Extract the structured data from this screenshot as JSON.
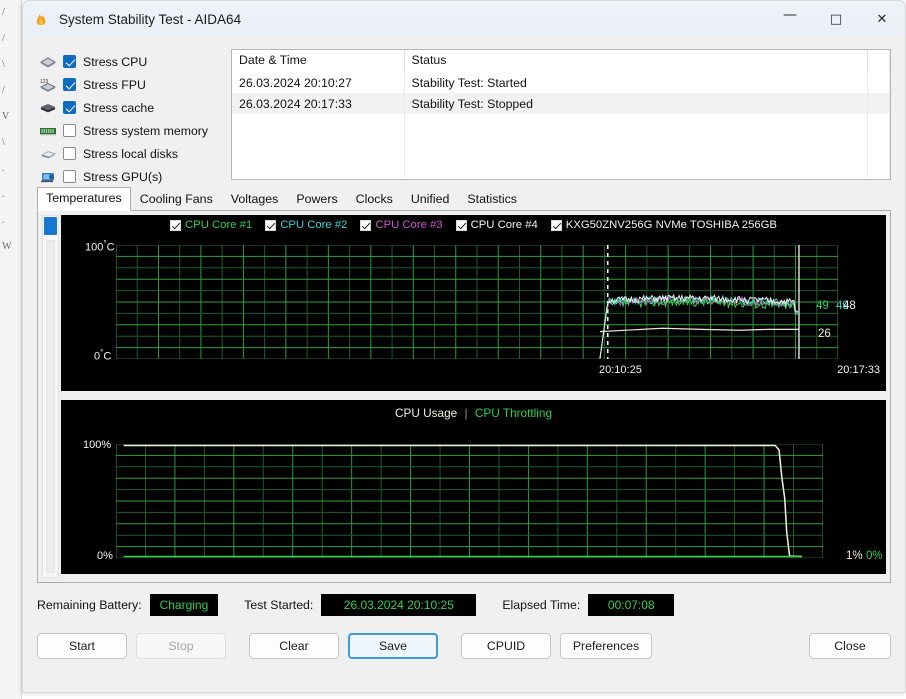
{
  "window": {
    "title": "System Stability Test - AIDA64",
    "app_icon": "aida64-flame-icon",
    "controls": {
      "minimize": "—",
      "maximize": "□",
      "close": "✕"
    }
  },
  "options": {
    "items": [
      {
        "label": "Stress CPU",
        "checked": true,
        "icon": "cpu-chip-icon"
      },
      {
        "label": "Stress FPU",
        "checked": true,
        "icon": "fpu-chip-icon"
      },
      {
        "label": "Stress cache",
        "checked": true,
        "icon": "cache-chip-icon"
      },
      {
        "label": "Stress system memory",
        "checked": false,
        "icon": "memory-module-icon"
      },
      {
        "label": "Stress local disks",
        "checked": false,
        "icon": "hard-disk-icon"
      },
      {
        "label": "Stress GPU(s)",
        "checked": false,
        "icon": "gpu-card-icon"
      }
    ]
  },
  "log": {
    "columns": [
      "Date & Time",
      "Status"
    ],
    "rows": [
      {
        "datetime": "26.03.2024 20:10:27",
        "status": "Stability Test: Started"
      },
      {
        "datetime": "26.03.2024 20:17:33",
        "status": "Stability Test: Stopped"
      }
    ]
  },
  "tabs": {
    "items": [
      "Temperatures",
      "Cooling Fans",
      "Voltages",
      "Powers",
      "Clocks",
      "Unified",
      "Statistics"
    ],
    "active": "Temperatures"
  },
  "temperature_graph": {
    "legend": [
      {
        "label": "CPU Core #1",
        "checked": true,
        "color": "#2fd14f"
      },
      {
        "label": "CPU Core #2",
        "checked": true,
        "color": "#36d6d6"
      },
      {
        "label": "CPU Core #3",
        "checked": true,
        "color": "#d152d1"
      },
      {
        "label": "CPU Core #4",
        "checked": true,
        "color": "#f2f2f2"
      },
      {
        "label": "KXG50ZNV256G NVMe TOSHIBA 256GB",
        "checked": true,
        "color": "#f2f2f2"
      }
    ],
    "y_top": "100",
    "y_bottom": "0",
    "y_unit": "C",
    "y_degree": "°",
    "x_start": "20:10:25",
    "x_end": "20:17:33",
    "readouts": [
      {
        "value": "49",
        "color": "#2fd14f"
      },
      {
        "value": "49",
        "color": "#36d6d6"
      },
      {
        "value": "48",
        "color": "#f2f2f2"
      },
      {
        "value": "26",
        "color": "#e8e8d8"
      }
    ]
  },
  "cpu_graph": {
    "title_usage": "CPU Usage",
    "title_separator": "|",
    "title_throttling": "CPU Throttling",
    "usage_color": "#f0efd8",
    "throttling_color": "#2fd14f",
    "y_top": "100%",
    "y_bottom": "0%",
    "readouts": [
      {
        "value": "1%",
        "color": "#f0efd8"
      },
      {
        "value": "0%",
        "color": "#2fd14f"
      }
    ]
  },
  "status": {
    "battery_label": "Remaining Battery:",
    "battery_value": "Charging",
    "started_label": "Test Started:",
    "started_value": "26.03.2024 20:10:25",
    "elapsed_label": "Elapsed Time:",
    "elapsed_value": "00:07:08",
    "led_color": "#2fd14f"
  },
  "buttons": {
    "start": "Start",
    "stop": "Stop",
    "clear": "Clear",
    "save": "Save",
    "cpuid": "CPUID",
    "preferences": "Preferences",
    "close": "Close"
  },
  "chart_data": [
    {
      "type": "line",
      "title": "Temperatures",
      "xlabel": "",
      "ylabel": "°C",
      "ylim": [
        0,
        100
      ],
      "x": [
        "20:10:25",
        "20:17:33"
      ],
      "series": [
        {
          "name": "CPU Core #1",
          "color": "#2fd14f",
          "last_value": 49
        },
        {
          "name": "CPU Core #2",
          "color": "#36d6d6",
          "last_value": 49
        },
        {
          "name": "CPU Core #3",
          "color": "#d152d1",
          "last_value": 49
        },
        {
          "name": "CPU Core #4",
          "color": "#f2f2f2",
          "last_value": 48
        },
        {
          "name": "KXG50ZNV256G NVMe TOSHIBA 256GB",
          "color": "#e8e8d8",
          "last_value": 26
        }
      ],
      "grid": true,
      "legend": "top"
    },
    {
      "type": "line",
      "title": "CPU Usage | CPU Throttling",
      "xlabel": "",
      "ylabel": "%",
      "ylim": [
        0,
        100
      ],
      "series": [
        {
          "name": "CPU Usage",
          "color": "#f0efd8",
          "last_value": 1
        },
        {
          "name": "CPU Throttling",
          "color": "#2fd14f",
          "last_value": 0
        }
      ],
      "grid": true,
      "legend": "top"
    }
  ]
}
